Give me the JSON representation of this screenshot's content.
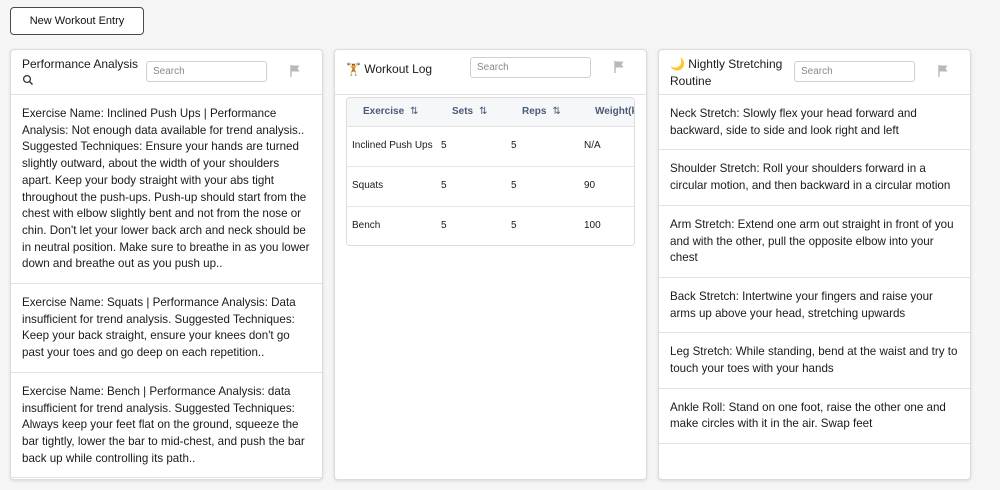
{
  "toolbar": {
    "new_entry_label": "New Workout Entry"
  },
  "performance": {
    "title": "Performance Analysis",
    "title_icon": "magnifier-emoji",
    "search_placeholder": "Search",
    "items": [
      "Exercise Name: Inclined Push Ups | Performance Analysis: Not enough data available for trend analysis.. Suggested Techniques: Ensure your hands are turned slightly outward, about the width of your shoulders apart. Keep your body straight with your abs tight throughout the push-ups. Push-up should start from the chest with elbow slightly bent and not from the nose or chin. Don't let your lower back arch and neck should be in neutral position. Make sure to breathe in as you lower down and breathe out as you push up..",
      "Exercise Name: Squats | Performance Analysis: Data insufficient for trend analysis. Suggested Techniques: Keep your back straight, ensure your knees don't go past your toes and go deep on each repetition..",
      "Exercise Name: Bench | Performance Analysis: data insufficient for trend analysis. Suggested Techniques: Always keep your feet flat on the ground, squeeze the bar tightly, lower the bar to mid-chest, and push the bar back up while controlling its path.."
    ]
  },
  "workout_log": {
    "title": "🏋 Workout Log",
    "search_placeholder": "Search",
    "sort_glyph": "⇅",
    "columns": [
      "Exercise",
      "Sets",
      "Reps",
      "Weight(kg)"
    ],
    "rows": [
      [
        "Inclined Push Ups",
        "5",
        "5",
        "N/A"
      ],
      [
        "Squats",
        "5",
        "5",
        "90"
      ],
      [
        "Bench",
        "5",
        "5",
        "100"
      ]
    ]
  },
  "stretching": {
    "title": "🌙 Nightly Stretching Routine",
    "search_placeholder": "Search",
    "items": [
      "Neck Stretch: Slowly flex your head forward and backward, side to side and look right and left",
      "Shoulder Stretch: Roll your shoulders forward in a circular motion, and then backward in a circular motion",
      "Arm Stretch: Extend one arm out straight in front of you and with the other, pull the opposite elbow into your chest",
      "Back Stretch: Intertwine your fingers and raise your arms up above your head, stretching upwards",
      "Leg Stretch: While standing, bend at the waist and try to touch your toes with your hands",
      "Ankle Roll: Stand on one foot, raise the other one and make circles with it in the air. Swap feet"
    ]
  },
  "icons": {
    "flag": "flag-icon",
    "sort": "sort-arrows-icon"
  },
  "colors": {
    "header_text": "#4a5a78",
    "flag": "#b8b8b8",
    "border": "#dcdcdc"
  }
}
